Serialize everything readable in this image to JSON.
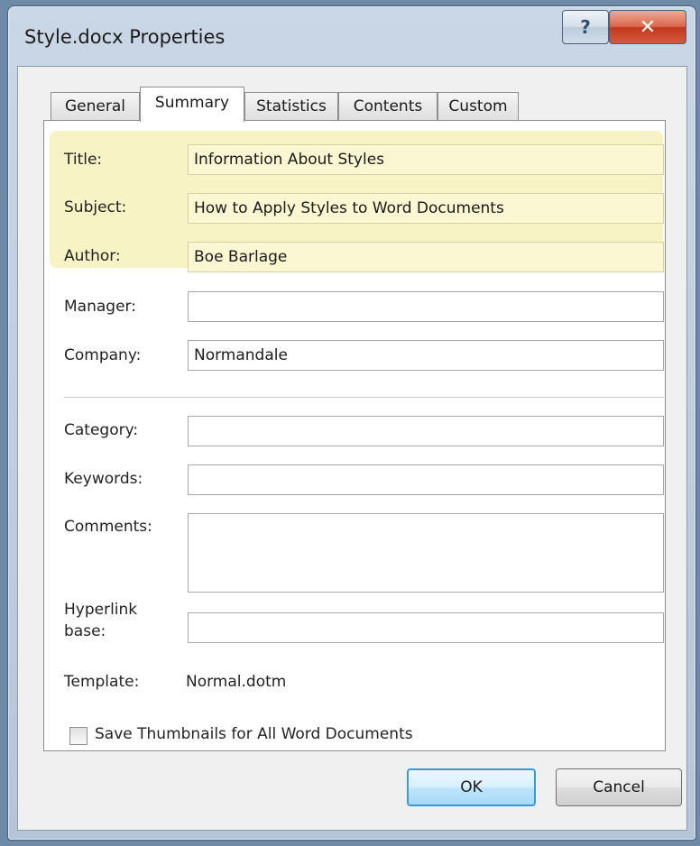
{
  "window": {
    "title": "Style.docx Properties"
  },
  "titlebar": {
    "help_glyph": "?",
    "close_glyph": "✕"
  },
  "tabs": [
    {
      "label": "General"
    },
    {
      "label": "Summary",
      "active": true
    },
    {
      "label": "Statistics"
    },
    {
      "label": "Contents"
    },
    {
      "label": "Custom"
    }
  ],
  "fields": {
    "title": {
      "label": "Title:",
      "value": "Information About Styles"
    },
    "subject": {
      "label": "Subject:",
      "value": "How to Apply Styles to Word Documents"
    },
    "author": {
      "label": "Author:",
      "value": "Boe Barlage"
    },
    "manager": {
      "label": "Manager:",
      "value": ""
    },
    "company": {
      "label": "Company:",
      "value": "Normandale"
    },
    "category": {
      "label": "Category:",
      "value": ""
    },
    "keywords": {
      "label": "Keywords:",
      "value": ""
    },
    "comments": {
      "label": "Comments:",
      "value": ""
    },
    "hyperlink_base": {
      "label_line1": "Hyperlink",
      "label_line2": "base:",
      "value": ""
    },
    "template": {
      "label": "Template:",
      "value": "Normal.dotm"
    }
  },
  "checkbox": {
    "label": "Save Thumbnails for All Word Documents",
    "checked": false
  },
  "buttons": {
    "ok": "OK",
    "cancel": "Cancel"
  },
  "colors": {
    "highlight": "#f8f3c4",
    "ok_border": "#3c9ad1",
    "close_red": "#c2391f"
  }
}
